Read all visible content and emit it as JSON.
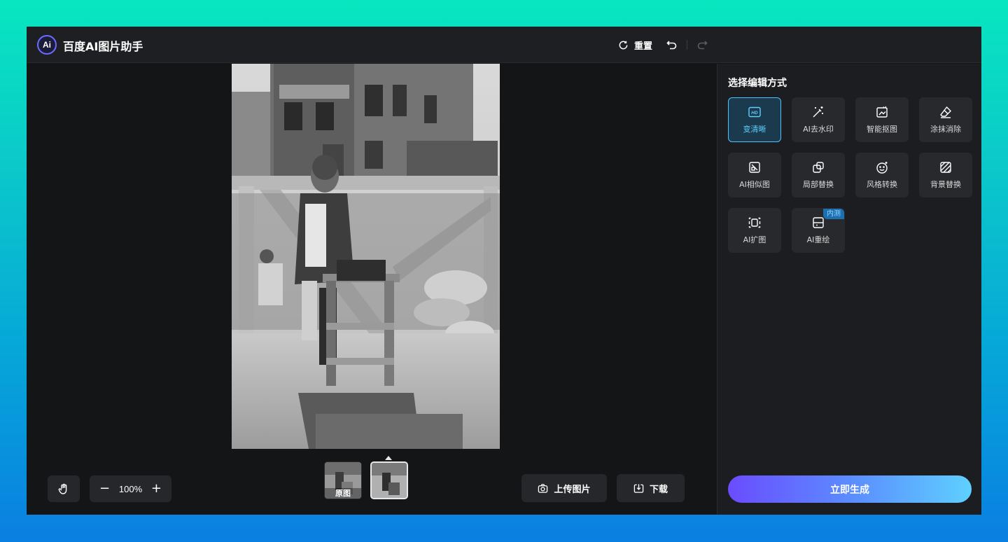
{
  "app": {
    "logo_text": "Ai",
    "title": "百度AI图片助手"
  },
  "toolbar": {
    "reset_label": "重置",
    "undo_icon": "undo-icon",
    "redo_icon": "redo-icon"
  },
  "canvas": {
    "zoom": "100%",
    "zoom_out_glyph": "−",
    "zoom_in_glyph": "+",
    "thumbnails": [
      {
        "label": "原图",
        "active": false
      },
      {
        "label": "",
        "active": true
      }
    ],
    "upload_label": "上传图片",
    "download_label": "下载"
  },
  "panel": {
    "title": "选择编辑方式",
    "tools": [
      {
        "label": "变清晰",
        "icon": "hd-icon",
        "selected": true
      },
      {
        "label": "AI去水印",
        "icon": "magic-wand-icon",
        "selected": false
      },
      {
        "label": "智能抠图",
        "icon": "cutout-icon",
        "selected": false
      },
      {
        "label": "涂抹消除",
        "icon": "eraser-icon",
        "selected": false
      },
      {
        "label": "AI相似图",
        "icon": "similar-image-icon",
        "selected": false
      },
      {
        "label": "局部替换",
        "icon": "partial-replace-icon",
        "selected": false
      },
      {
        "label": "风格转换",
        "icon": "style-transfer-icon",
        "selected": false
      },
      {
        "label": "背景替换",
        "icon": "background-replace-icon",
        "selected": false
      },
      {
        "label": "AI扩图",
        "icon": "expand-icon",
        "selected": false
      },
      {
        "label": "AI重绘",
        "icon": "redraw-icon",
        "selected": false,
        "badge": "内测"
      }
    ],
    "generate_label": "立即生成"
  },
  "colors": {
    "accent": "#4cc3ff",
    "gradient_start": "#6a4cff",
    "gradient_end": "#5fd0ff",
    "window_bg": "#141516"
  }
}
